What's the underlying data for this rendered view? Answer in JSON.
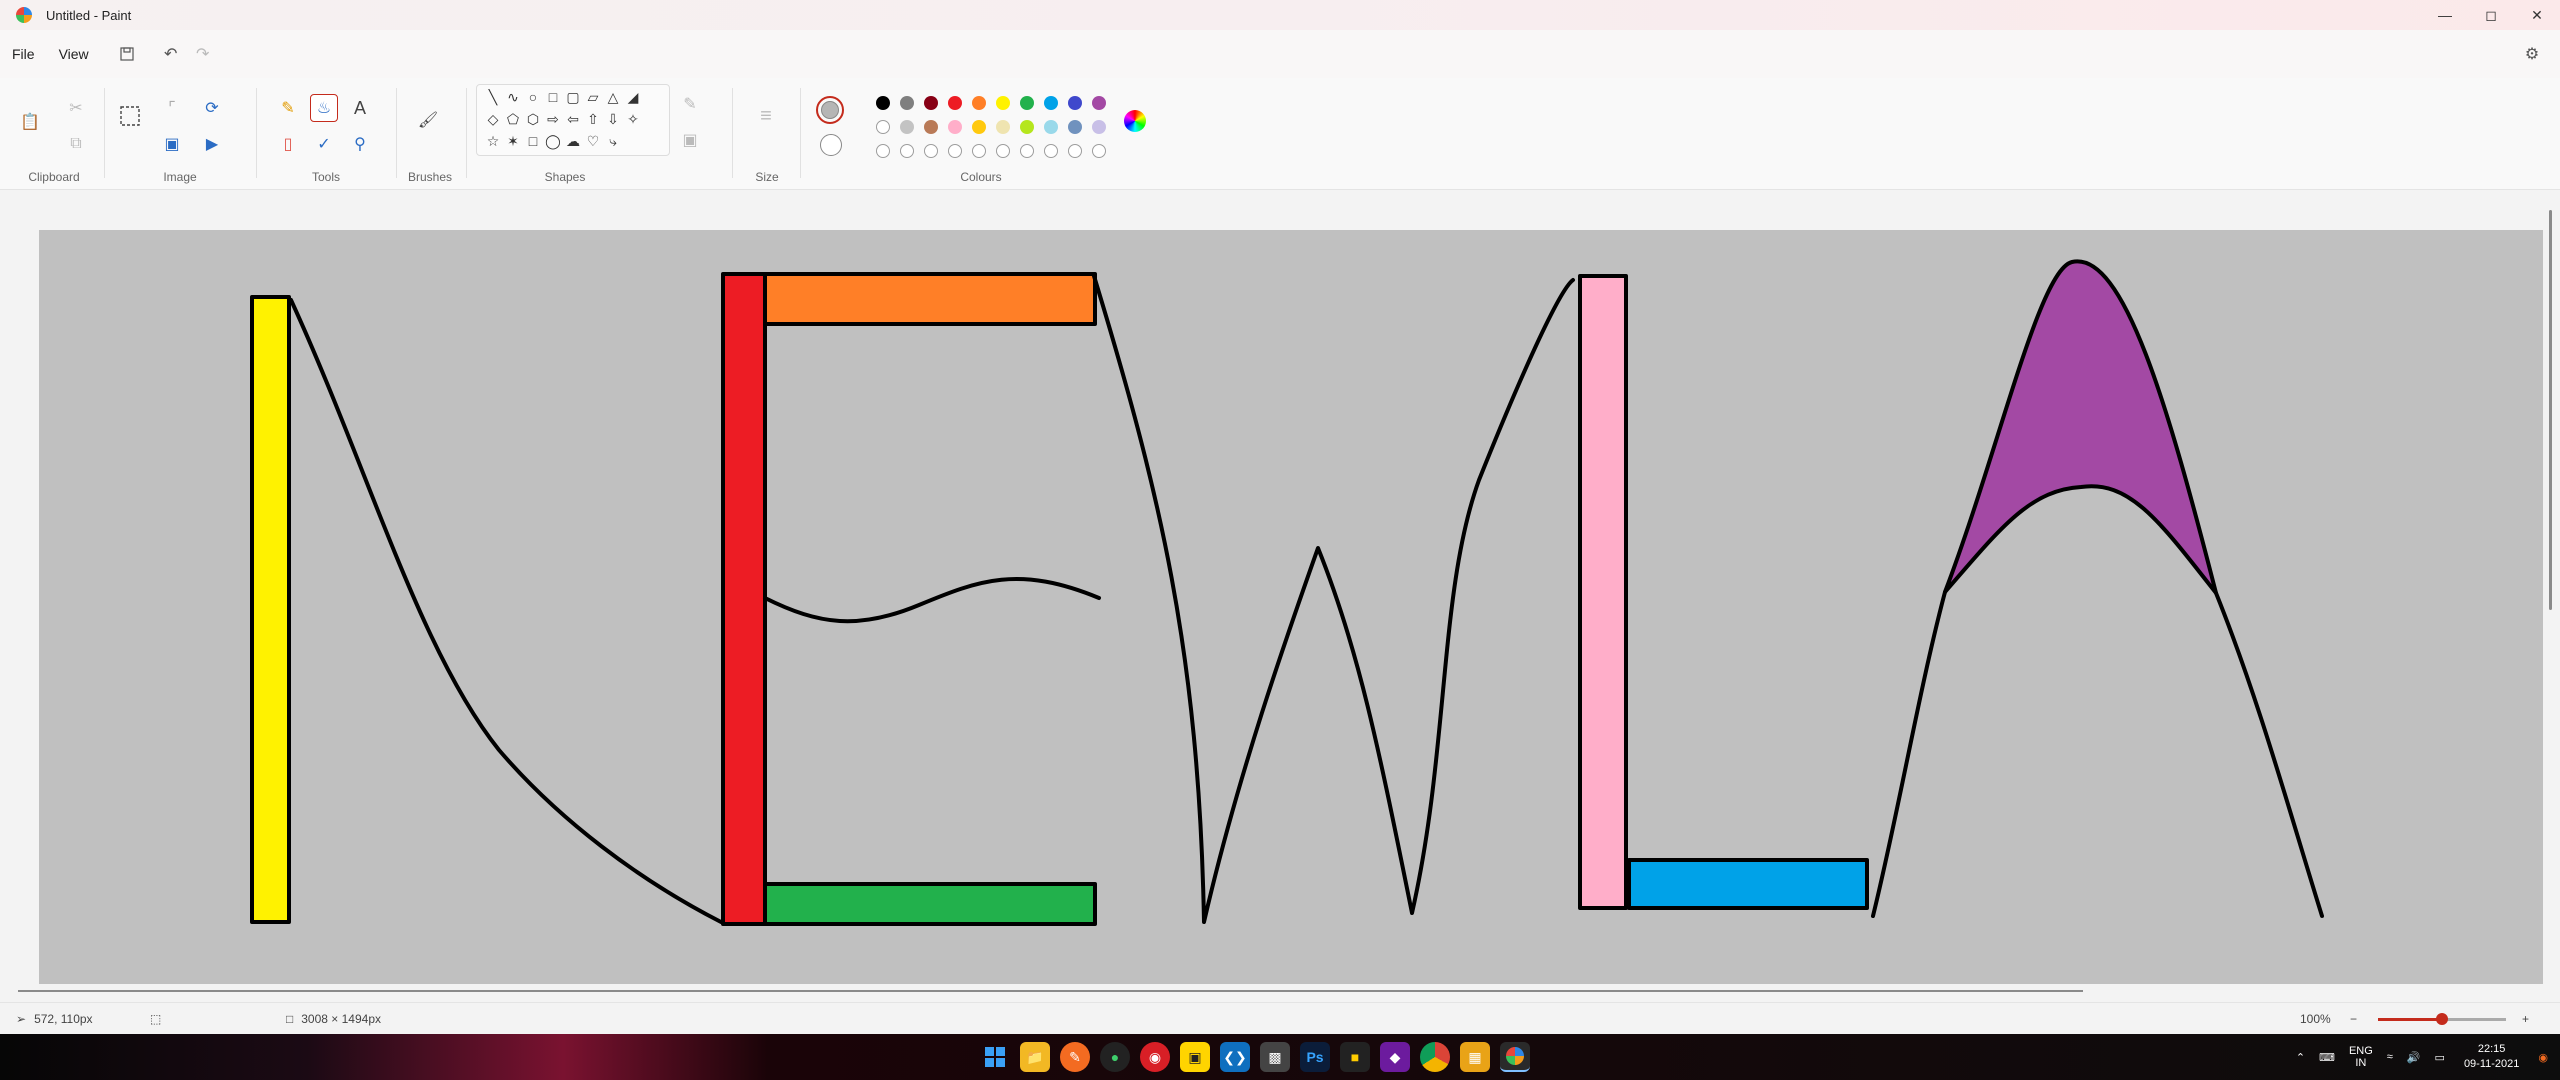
{
  "window": {
    "title": "Untitled - Paint",
    "controls": [
      "minimize",
      "maximize",
      "close"
    ]
  },
  "menu": {
    "file": "File",
    "view": "View"
  },
  "ribbon": {
    "groups": {
      "clipboard": "Clipboard",
      "image": "Image",
      "tools": "Tools",
      "brushes": "Brushes",
      "shapes": "Shapes",
      "size": "Size",
      "colours": "Colours"
    },
    "palette_row1": [
      "#000000",
      "#7f7f7f",
      "#880015",
      "#ed1c24",
      "#ff7f27",
      "#fff200",
      "#22b14c",
      "#00a2e8",
      "#3f48cc",
      "#a349a4"
    ],
    "palette_row2": [
      "#ffffff",
      "#c3c3c3",
      "#b97a57",
      "#ffaec9",
      "#ffc90e",
      "#efe4b0",
      "#b5e61d",
      "#99d9ea",
      "#7092be",
      "#c8bfe7"
    ],
    "colour1": "#b5b5b5",
    "colour2": "#ffffff"
  },
  "canvas": {
    "background": "#c0c0c0",
    "fills": {
      "yellow": "#fff200",
      "red": "#ed1c24",
      "orange": "#ff7f27",
      "green": "#22b14c",
      "pink": "#ffaec9",
      "blue": "#00a2e8",
      "purple": "#a349a4"
    }
  },
  "status": {
    "cursor_position": "572, 110px",
    "canvas_size": "3008 × 1494px",
    "zoom": "100%",
    "zoom_level": 0.5
  },
  "taskbar": {
    "lang_top": "ENG",
    "lang_bottom": "IN",
    "time": "22:15",
    "date": "09-11-2021",
    "apps": [
      "start",
      "file-explorer",
      "app-orange",
      "app-green",
      "app-red",
      "app-yellow",
      "vscode",
      "app-dark",
      "photoshop",
      "app-yellow-square",
      "app-purple",
      "chrome",
      "app-folder",
      "paint"
    ]
  }
}
